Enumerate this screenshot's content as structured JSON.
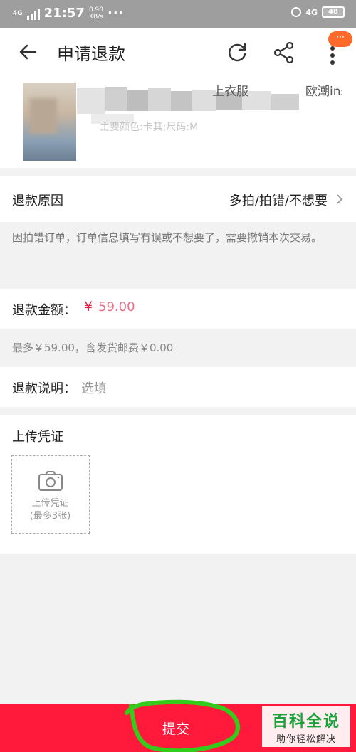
{
  "status_bar": {
    "network": "4G",
    "time": "21:57",
    "speed_value": "0.90",
    "speed_unit": "KB/s",
    "more": "···",
    "network_right": "4G",
    "battery": "48"
  },
  "header": {
    "title": "申请退款",
    "icons": {
      "back": "arrow-left",
      "refresh": "refresh",
      "share": "share",
      "more": "more-vertical"
    },
    "badge": "···"
  },
  "product": {
    "title_partial": "上衣服",
    "title_partial_end": "欧潮ins",
    "spec": "主要颜色:卡其;尺码:M"
  },
  "refund_reason": {
    "label": "退款原因",
    "value": "多拍/拍错/不想要",
    "description": "因拍错订单，订单信息填写有误或不想要了，需要撤销本次交易。"
  },
  "refund_amount": {
    "label": "退款金额：",
    "currency": "¥",
    "value": "59.00",
    "note": "最多￥59.00，含发货邮费￥0.00"
  },
  "refund_note": {
    "label": "退款说明：",
    "placeholder": "选填"
  },
  "upload": {
    "title": "上传凭证",
    "box_line1": "上传凭证",
    "box_line2": "(最多3张)"
  },
  "submit": {
    "label": "提交"
  },
  "watermark": {
    "title": "百科全说",
    "subtitle": "助你轻松解决"
  },
  "colors": {
    "accent": "#ff1a3c",
    "price": "#e8708a",
    "annotation": "#33cc1a",
    "watermark": "#19a33c"
  }
}
